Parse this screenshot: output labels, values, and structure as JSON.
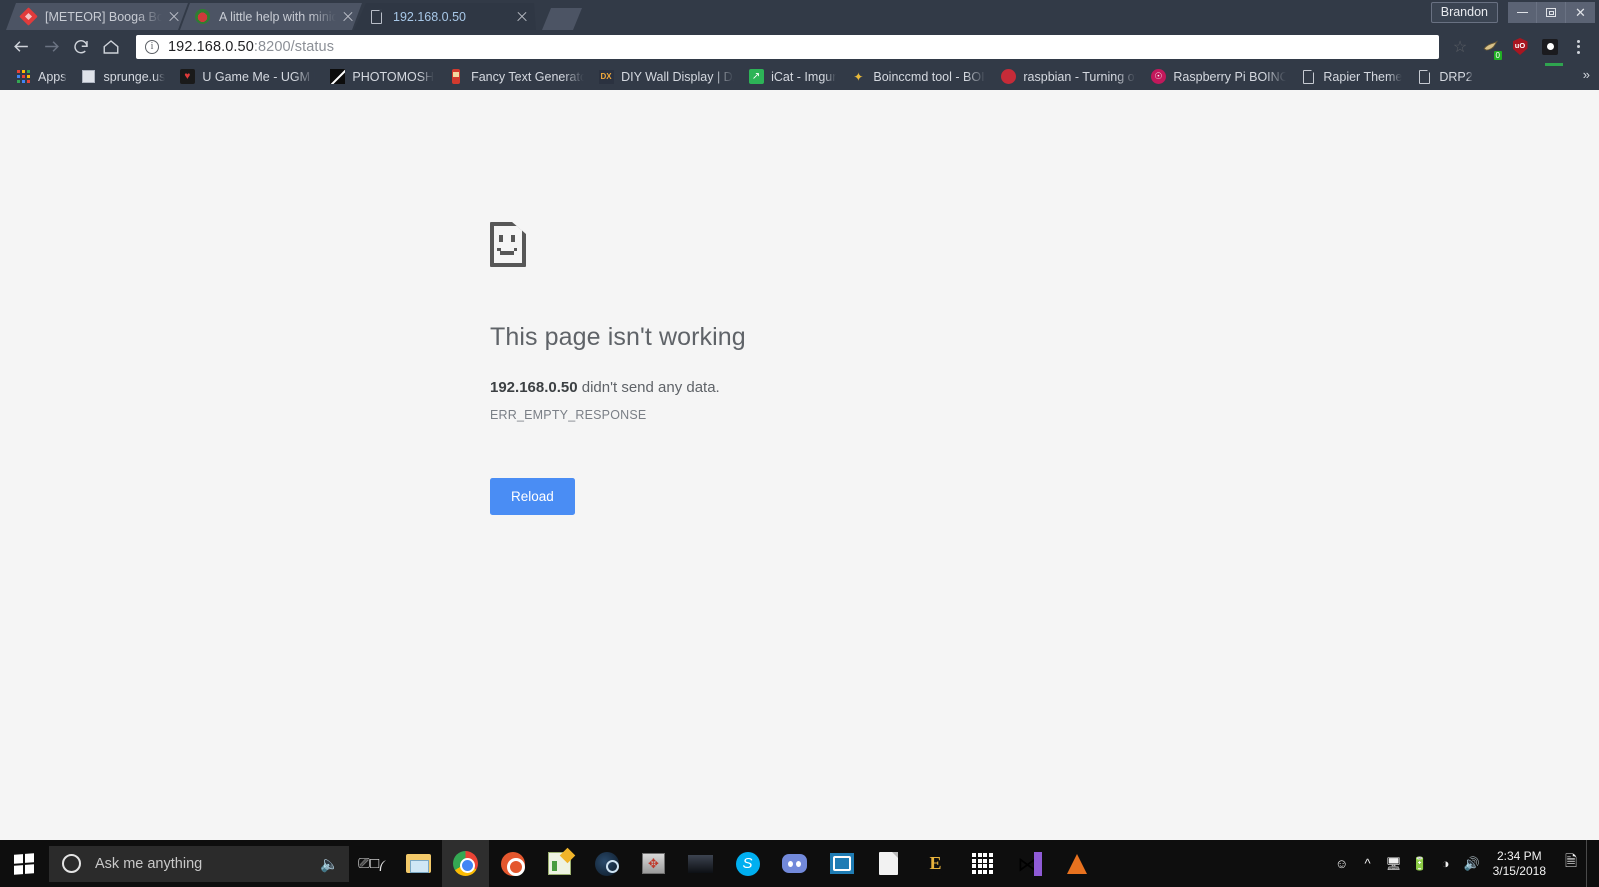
{
  "window": {
    "profile_label": "Brandon",
    "controls": {
      "minimize": "minimize-button",
      "maximize": "restore-button",
      "close": "close-button"
    }
  },
  "tabs": [
    {
      "title": "[METEOR] Booga Booga",
      "favicon": "roblox-icon",
      "active": false
    },
    {
      "title": "A little help with minidlna",
      "favicon": "raspberry-pi-icon",
      "active": false
    },
    {
      "title": "192.168.0.50",
      "favicon": "document-icon",
      "active": true
    }
  ],
  "newtab_label": "New tab",
  "toolbar": {
    "back": "back-arrow",
    "forward": "forward-arrow",
    "reload": "reload-arrow",
    "home": "home-icon",
    "url_secure_part": "192.168.0.50",
    "url_dim_part": ":8200/status",
    "url_full": "192.168.0.50:8200/status",
    "info_icon": "i",
    "star": "☆",
    "extensions": [
      {
        "name": "ext-slingshot",
        "badge": "0"
      },
      {
        "name": "ublock-origin",
        "label": "uO"
      },
      {
        "name": "ext-dark-square",
        "badge": ""
      }
    ],
    "menu": "chrome-menu"
  },
  "bookmarks": {
    "overflow": "»",
    "items": [
      {
        "label": "Apps",
        "icon": "apps-grid-icon"
      },
      {
        "label": "sprunge.us",
        "icon": "news-icon"
      },
      {
        "label": "U Game Me - UGM Fr",
        "icon": "ugm-icon"
      },
      {
        "label": "PHOTOMOSH",
        "icon": "photomosh-icon"
      },
      {
        "label": "Fancy Text Generator",
        "icon": "fancy-text-icon"
      },
      {
        "label": "DIY Wall Display | DA",
        "icon": "dx-icon"
      },
      {
        "label": "iCat - Imgur",
        "icon": "icat-icon"
      },
      {
        "label": "Boinccmd tool - BOIN",
        "icon": "boinc-icon"
      },
      {
        "label": "raspbian - Turning of",
        "icon": "raspbian-icon"
      },
      {
        "label": "Raspberry Pi BOINC T",
        "icon": "raspberry-pi-boinc-icon"
      },
      {
        "label": "Rapier Theme",
        "icon": "page-icon"
      },
      {
        "label": "DRP2",
        "icon": "page-icon"
      }
    ]
  },
  "error_page": {
    "icon": "sad-document-icon",
    "title": "This page isn't working",
    "detail_host": "192.168.0.50",
    "detail_rest": " didn't send any data.",
    "code": "ERR_EMPTY_RESPONSE",
    "reload_label": "Reload",
    "accent_color": "#4a8df4",
    "background_color": "#f5f5f5"
  },
  "taskbar": {
    "start": "windows-start-icon",
    "search_placeholder": "Ask me anything",
    "mic_icon": "microphone-icon",
    "task_view": "task-view-icon",
    "apps": [
      {
        "name": "file-explorer",
        "active": false
      },
      {
        "name": "google-chrome",
        "active": true
      },
      {
        "name": "ubuntu",
        "active": false
      },
      {
        "name": "notepad-plus-plus",
        "active": false
      },
      {
        "name": "steam",
        "active": false
      },
      {
        "name": "display-mover",
        "active": false
      },
      {
        "name": "dark-app",
        "active": false
      },
      {
        "name": "skype",
        "active": false
      },
      {
        "name": "discord",
        "active": false
      },
      {
        "name": "remote-desktop",
        "active": false
      },
      {
        "name": "file-document",
        "active": false
      },
      {
        "name": "e-app",
        "active": false
      },
      {
        "name": "calculator",
        "active": false
      },
      {
        "name": "visual-studio-code",
        "active": false
      },
      {
        "name": "vlc-media-player",
        "active": false
      }
    ],
    "tray": [
      {
        "name": "people-icon",
        "glyph": "☻"
      },
      {
        "name": "show-hidden-icons-chevron",
        "glyph": "⌃"
      },
      {
        "name": "network-monitor-icon",
        "glyph": "⌸"
      },
      {
        "name": "battery-icon",
        "glyph": "▭"
      },
      {
        "name": "wifi-icon",
        "glyph": "◠"
      },
      {
        "name": "volume-icon",
        "glyph": "🔊"
      }
    ],
    "clock_time": "2:34 PM",
    "clock_date": "3/15/2018",
    "action_center": "notification-icon"
  }
}
